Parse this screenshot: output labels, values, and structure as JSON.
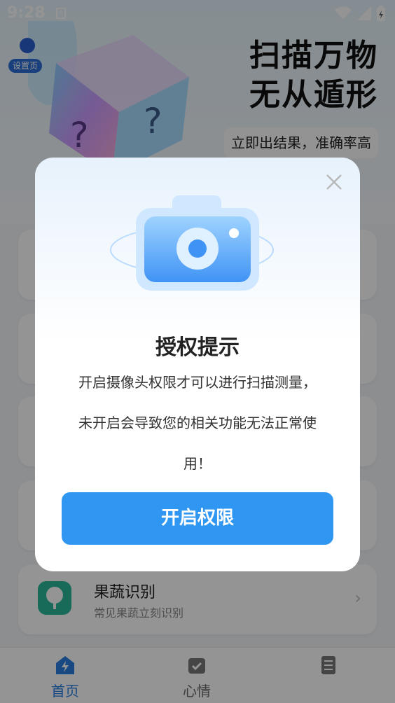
{
  "status_bar": {
    "time": "9:28",
    "notification_icon": "a-accessibility-icon",
    "icons": [
      "wifi-icon",
      "signal-icon",
      "battery-icon"
    ]
  },
  "hero": {
    "settings_label": "设置页",
    "title_line1": "扫描万物",
    "title_line2": "无从遁形",
    "subtitle": "立即出结果，准确率高"
  },
  "cards": [
    {
      "title": "果蔬识别",
      "desc": "常见果蔬立刻识别",
      "icon": "tree-icon"
    }
  ],
  "tabbar": {
    "tabs": [
      {
        "label": "首页",
        "icon": "home-bolt-icon",
        "active": true
      },
      {
        "label": "心情",
        "icon": "calendar-icon",
        "active": false
      },
      {
        "label": "",
        "icon": "document-icon",
        "active": false
      }
    ]
  },
  "dialog": {
    "title": "授权提示",
    "message_line1": "开启摄像头权限才可以进行扫描测量，",
    "message_line2": "未开启会导致您的相关功能无法正常使",
    "message_line3": "用！",
    "button_label": "开启权限",
    "close_icon": "close-icon"
  },
  "colors": {
    "accent": "#2f96f2",
    "scrim": "rgba(0,0,0,0.42)",
    "card_icon": "#2bb89a"
  }
}
